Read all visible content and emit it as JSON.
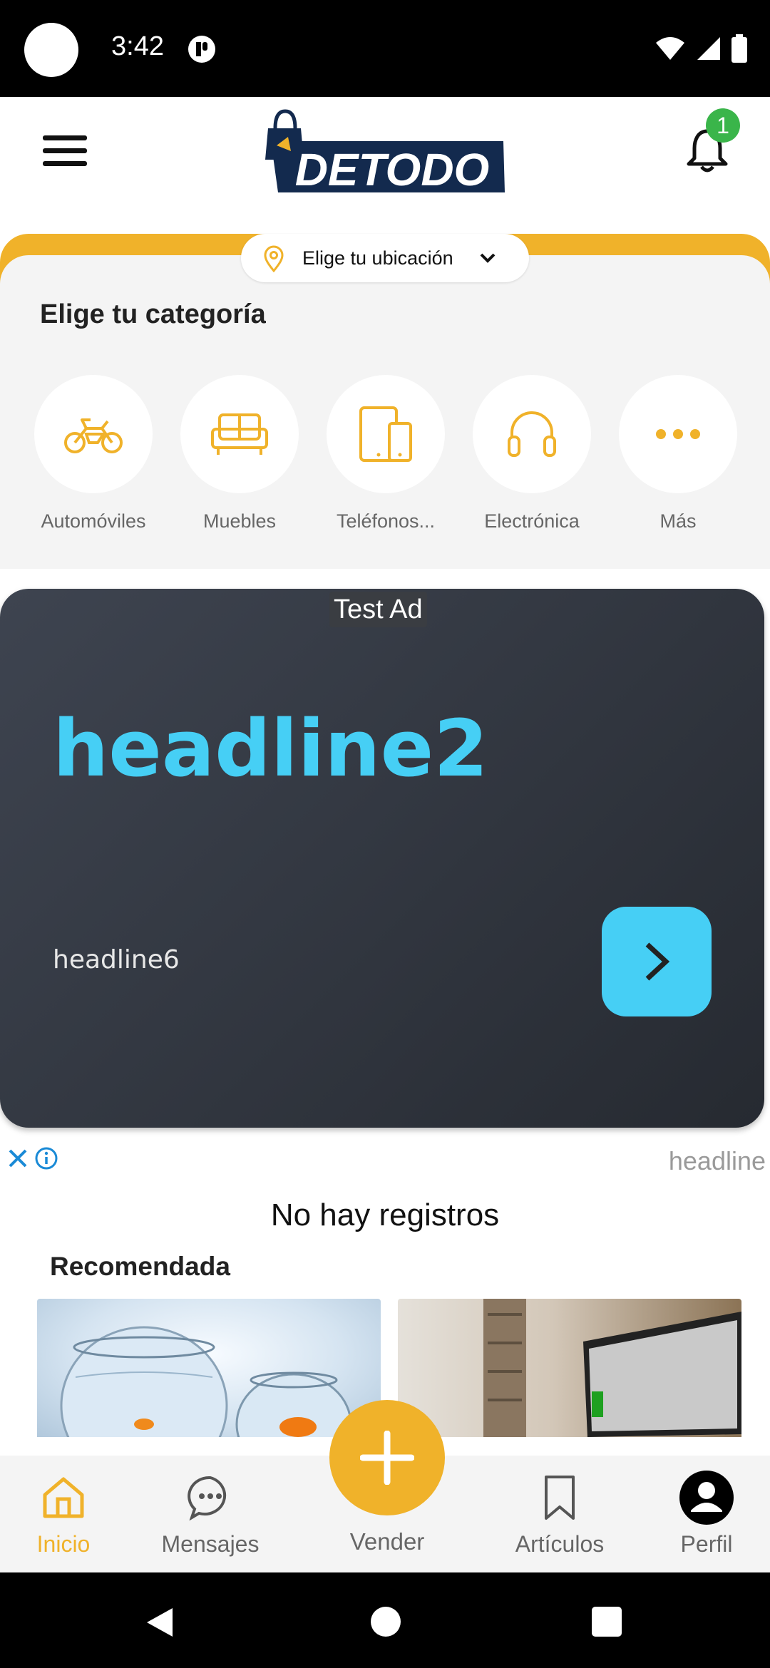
{
  "status_bar": {
    "time": "3:42"
  },
  "header": {
    "logo_text": "DETODO",
    "notification_count": "1"
  },
  "location": {
    "label": "Elige tu ubicación"
  },
  "categories": {
    "title": "Elige tu categoría",
    "items": [
      {
        "label": "Automóviles",
        "icon": "motorcycle-icon"
      },
      {
        "label": "Muebles",
        "icon": "sofa-icon"
      },
      {
        "label": "Teléfonos...",
        "icon": "phone-tablet-icon"
      },
      {
        "label": "Electrónica",
        "icon": "headphones-icon"
      },
      {
        "label": "Más",
        "icon": "more-dots-icon"
      }
    ]
  },
  "ad": {
    "tag": "Test Ad",
    "headline": "headline2",
    "subline": "headline6",
    "footer_headline": "headline"
  },
  "content": {
    "empty_message": "No hay registros",
    "recommended_title": "Recomendada"
  },
  "bottom_nav": {
    "items": [
      {
        "label": "Inicio",
        "icon": "home-icon",
        "active": true
      },
      {
        "label": "Mensajes",
        "icon": "chat-bubble-icon"
      },
      {
        "label": "Vender",
        "icon": "plus-icon"
      },
      {
        "label": "Artículos",
        "icon": "bookmark-icon"
      },
      {
        "label": "Perfil",
        "icon": "profile-icon"
      }
    ]
  },
  "colors": {
    "accent": "#f0b22a",
    "ad_cyan": "#46cff5",
    "badge_green": "#3ab54a",
    "logo_navy": "#132a4e"
  }
}
